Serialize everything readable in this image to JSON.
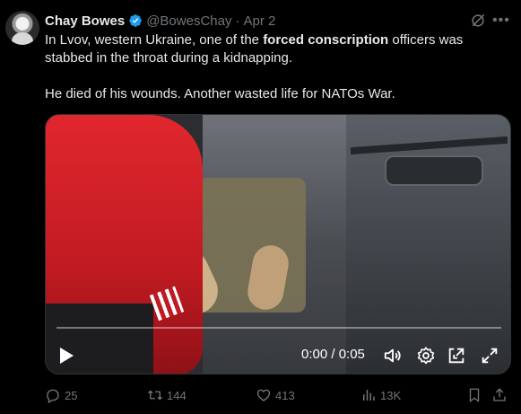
{
  "tweet": {
    "author_name": "Chay Bowes",
    "handle": "@BowesChay",
    "separator": "·",
    "date": "Apr 2",
    "text_line1": "In Lvov, western Ukraine, one of the ",
    "text_bold": "forced conscription",
    "text_line1_end": " officers was",
    "text_line2": "stabbed in the throat during a kidnapping.",
    "text_line3": "He died of his wounds. Another wasted life for NATOs War."
  },
  "video": {
    "time_display": "0:00 / 0:05",
    "progress": 0
  },
  "actions": {
    "replies": "25",
    "retweets": "144",
    "likes": "413",
    "views": "13K"
  },
  "colors": {
    "background": "#000000",
    "text": "#e7e9ea",
    "muted": "#71767b",
    "verified": "#1d9bf0"
  },
  "icons": [
    "verified-badge-icon",
    "grok-icon",
    "more-icon",
    "play-icon",
    "volume-icon",
    "gear-icon",
    "dock-icon",
    "expand-icon",
    "reply-icon",
    "retweet-icon",
    "like-icon",
    "views-icon",
    "bookmark-icon",
    "share-icon"
  ]
}
